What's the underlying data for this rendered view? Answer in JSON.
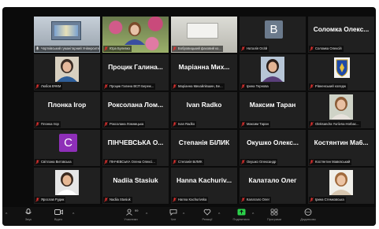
{
  "participants": [
    {
      "big": "",
      "label": "Чортківський гуманітарний Університет (Біл...",
      "mic_muted": false,
      "avatar": "scene-hall",
      "active": true
    },
    {
      "big": "",
      "label": "Юра Булевко",
      "mic_muted": true,
      "avatar": "scene-flowers"
    },
    {
      "big": "",
      "label": "Бобровицький фаховий ко...",
      "mic_muted": true,
      "avatar": "scene-room"
    },
    {
      "big": "",
      "label": "Наталія Осіїй",
      "mic_muted": true,
      "avatar": "letter",
      "letter": "B",
      "letter_color": "#6b7a8c"
    },
    {
      "big": "Соломка Олекс...",
      "label": "Соломка Олексій",
      "mic_muted": true
    },
    {
      "big": "",
      "label": "Любов ВЧКМ",
      "mic_muted": true,
      "avatar": "photo-woman"
    },
    {
      "big": "Процик Галина...",
      "label": "Процик Галина ВСП Береж...",
      "mic_muted": true
    },
    {
      "big": "Маріанна Мих...",
      "label": "Маріанна Михайлівшин, Бе...",
      "mic_muted": true
    },
    {
      "big": "",
      "label": "Ірина Тернова",
      "mic_muted": true,
      "avatar": "photo-woman2"
    },
    {
      "big": "",
      "label": "Рівненський коледж",
      "mic_muted": true,
      "avatar": "emblem"
    },
    {
      "big": "Плонка Ігор",
      "label": "Плонка Ігор",
      "mic_muted": true
    },
    {
      "big": "Роксолана Лом...",
      "label": "Роксолана Ломницька",
      "mic_muted": true
    },
    {
      "big": "Ivan Radko",
      "label": "Ivan Radko",
      "mic_muted": true
    },
    {
      "big": "Максим Таран",
      "label": "Максим Таран",
      "mic_muted": true
    },
    {
      "big": "",
      "label": "Oleksandra Yuriivna Horbac...",
      "mic_muted": true,
      "avatar": "photo-woman3"
    },
    {
      "big": "",
      "label": "Світлана Витовська",
      "mic_muted": true,
      "avatar": "letter",
      "letter": "C",
      "letter_color": "#8e2fb8"
    },
    {
      "big": "ПІНЧЕВСЬКА О...",
      "label": "ПІНЧЕВСЬКА Олена Олексі...",
      "mic_muted": true
    },
    {
      "big": "Степанія БІЛИК",
      "label": "Степанія БІЛИК",
      "mic_muted": true
    },
    {
      "big": "Окушко Олекс...",
      "label": "Окушко Олександр",
      "mic_muted": true
    },
    {
      "big": "Костянтин Ма6...",
      "label": "Костянтин Мавєвський",
      "mic_muted": true
    },
    {
      "big": "",
      "label": "Ярослав Рудик",
      "mic_muted": true,
      "avatar": "photo-man"
    },
    {
      "big": "Nadiia Stasiuk",
      "label": "Nadiia Stasiuk",
      "mic_muted": true
    },
    {
      "big": "Hanna Kachuriv...",
      "label": "Hanna Kachurivska",
      "mic_muted": true
    },
    {
      "big": "Калатало Олег",
      "label": "Калатало Олег",
      "mic_muted": true
    },
    {
      "big": "",
      "label": "Ірина Стемковська",
      "mic_muted": true,
      "avatar": "photo-woman4"
    }
  ],
  "toolbar": {
    "items": [
      {
        "name": "audio",
        "label": "Звук",
        "icon": "mic-icon"
      },
      {
        "name": "video",
        "label": "Відео",
        "icon": "video-icon"
      },
      {
        "name": "participants",
        "label": "Учасники",
        "icon": "participants-icon",
        "count": "99"
      },
      {
        "name": "chat",
        "label": "Чат",
        "icon": "chat-icon"
      },
      {
        "name": "reactions",
        "label": "Реакції",
        "icon": "reaction-icon"
      },
      {
        "name": "share",
        "label": "Поділитися",
        "icon": "share-icon"
      },
      {
        "name": "apps",
        "label": "Програми",
        "icon": "apps-icon"
      },
      {
        "name": "more",
        "label": "Додатково",
        "icon": "more-icon"
      }
    ]
  },
  "colors": {
    "accent_green": "#2bd14a",
    "mute_red": "#e0312f",
    "tile_bg": "#202020"
  }
}
